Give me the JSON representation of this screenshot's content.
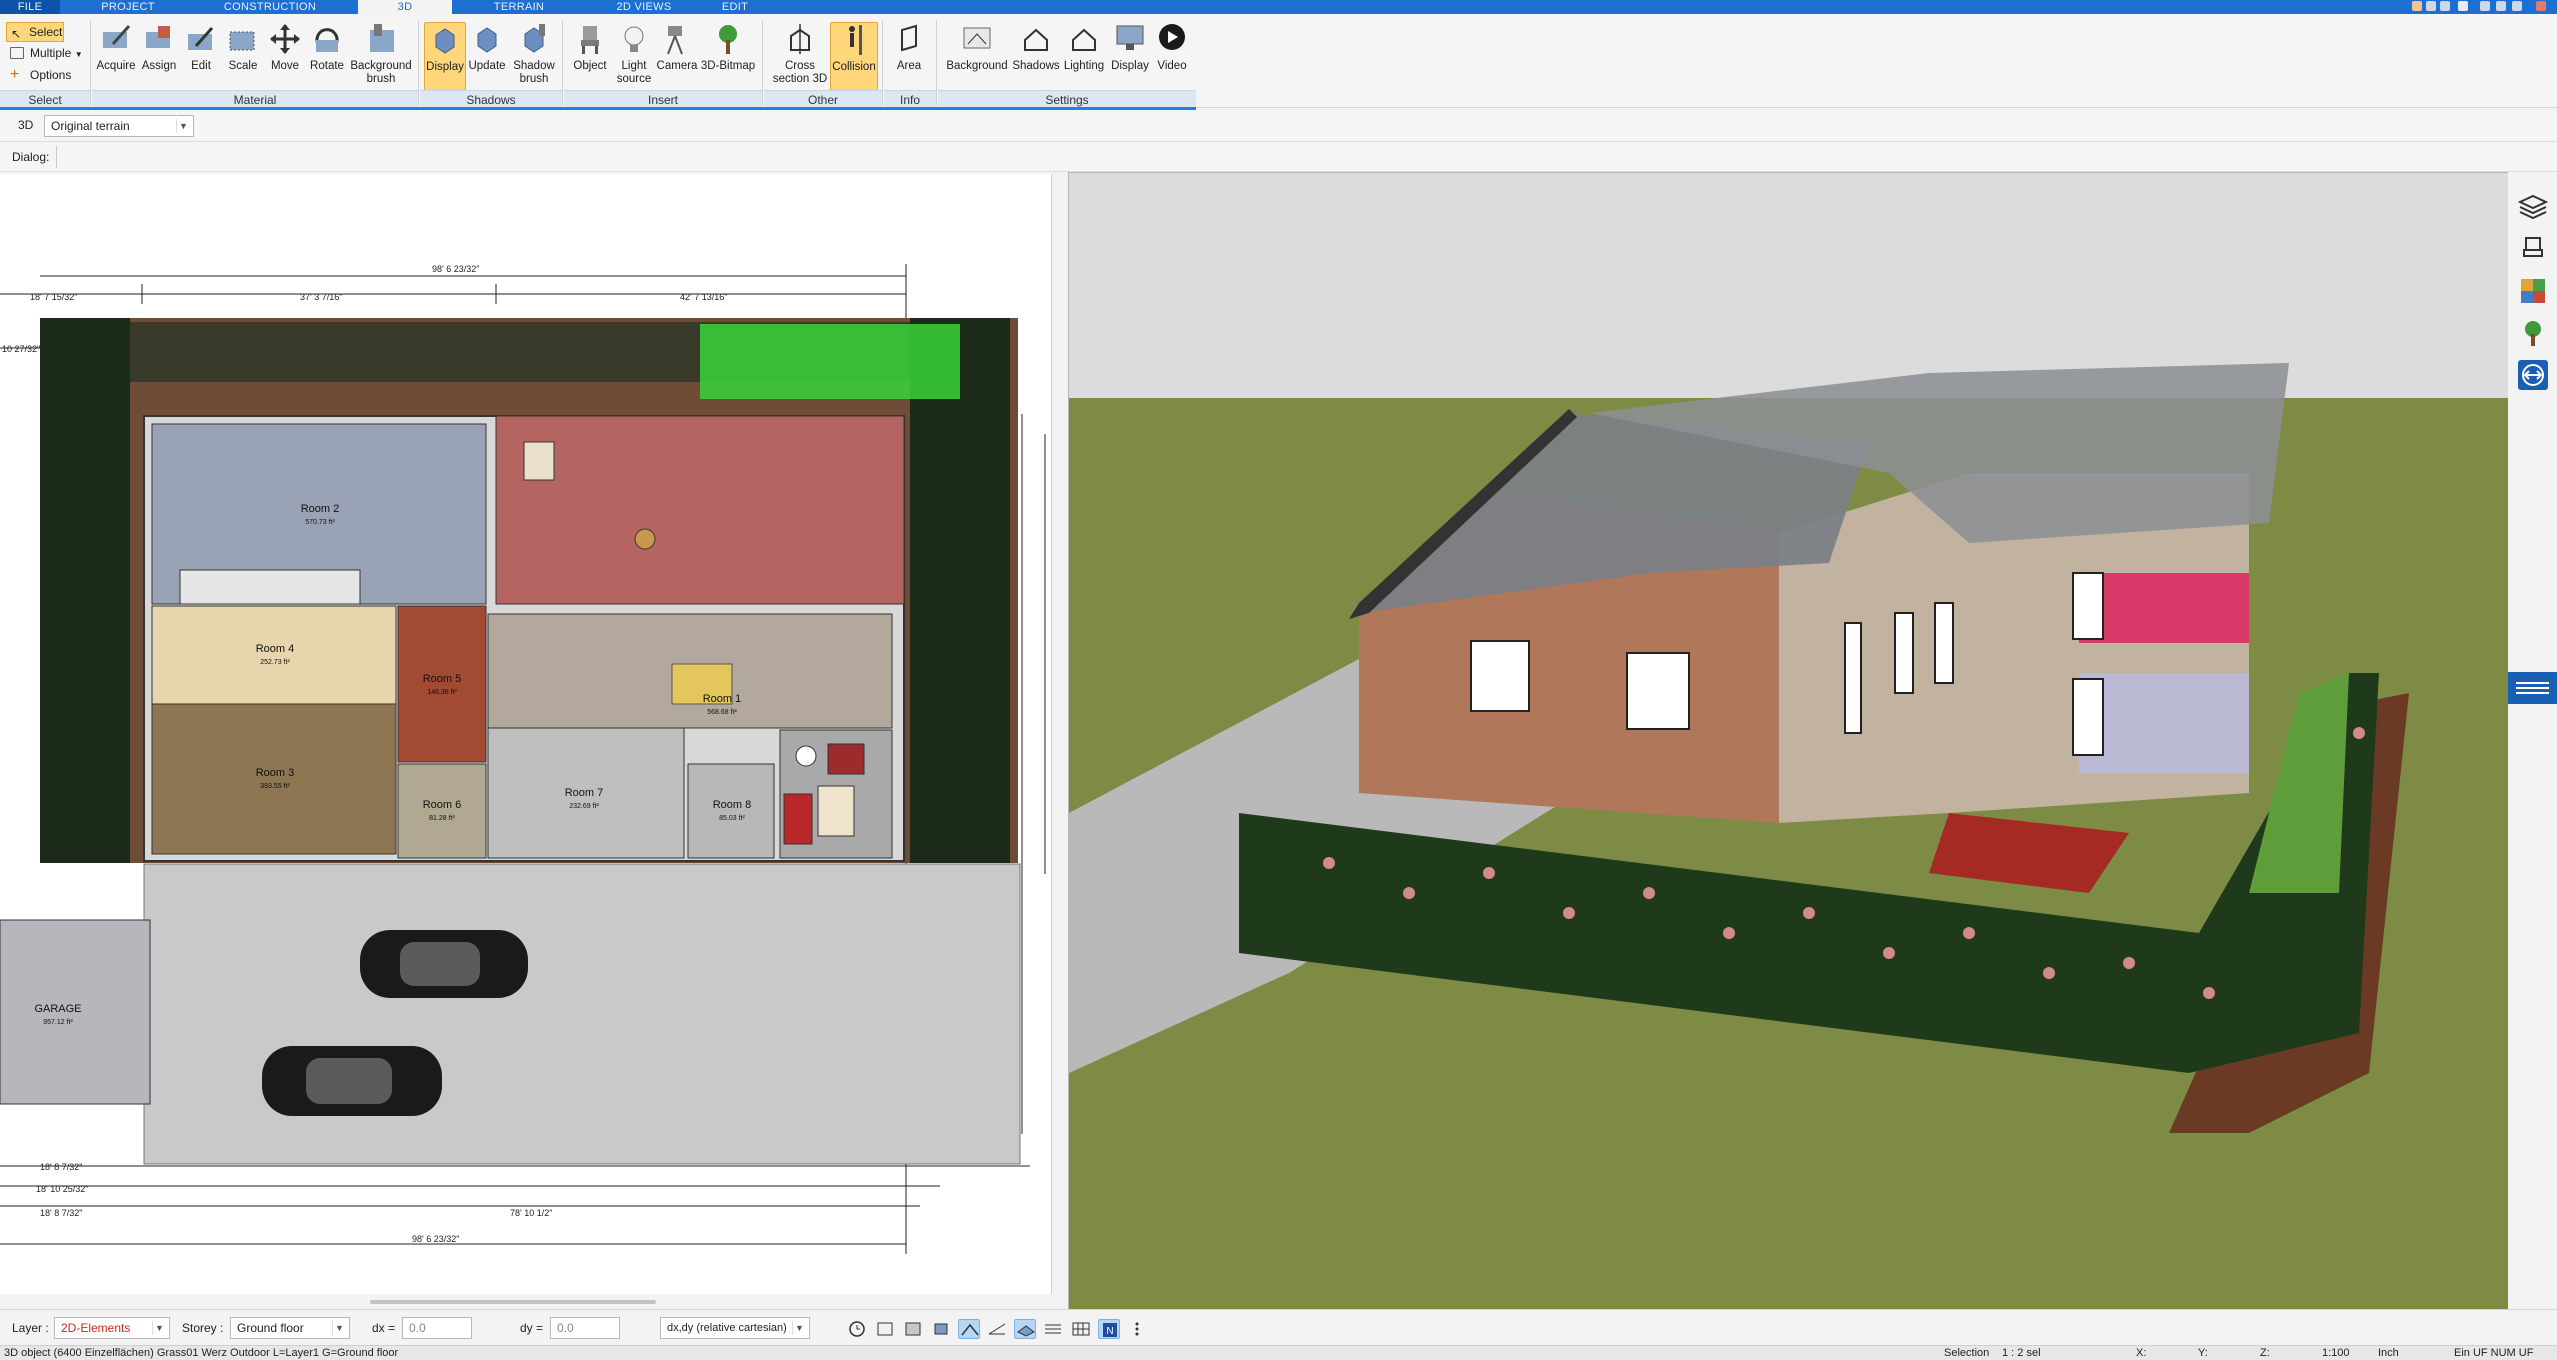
{
  "tabs": [
    {
      "label": "FILE"
    },
    {
      "label": "PROJECT"
    },
    {
      "label": "CONSTRUCTION"
    },
    {
      "label": "3D"
    },
    {
      "label": "TERRAIN"
    },
    {
      "label": "2D VIEWS"
    },
    {
      "label": "EDIT"
    }
  ],
  "ribbon": {
    "select": {
      "label": "Select",
      "multiple": "Multiple",
      "options": "Options",
      "group": "Select"
    },
    "material": {
      "group": "Material",
      "buttons": [
        "Acquire",
        "Assign",
        "Edit",
        "Scale",
        "Move",
        "Rotate",
        "Background brush"
      ]
    },
    "shadows": {
      "group": "Shadows",
      "buttons": [
        "Display",
        "Update",
        "Shadow brush"
      ]
    },
    "insert": {
      "group": "Insert",
      "buttons": [
        "Object",
        "Light source",
        "Camera",
        "3D-Bitmap"
      ]
    },
    "other": {
      "group": "Other",
      "buttons": [
        "Cross section 3D",
        "Collision"
      ]
    },
    "info": {
      "group": "Info",
      "buttons": [
        "Area"
      ]
    },
    "settings": {
      "group": "Settings",
      "buttons": [
        "Background",
        "Shadows",
        "Lighting",
        "Display",
        "Video"
      ]
    }
  },
  "context": {
    "mode": "3D",
    "terrain_select": "Original terrain"
  },
  "dialog": {
    "label": "Dialog:"
  },
  "plan": {
    "rooms": [
      {
        "name": "Room 2",
        "area": "570.73 ft²"
      },
      {
        "name": "Room 4",
        "area": "252.73 ft²"
      },
      {
        "name": "Room 3",
        "area": "393.55 ft²"
      },
      {
        "name": "Room 5",
        "area": "146.36 ft²"
      },
      {
        "name": "Room 1",
        "area": "568.68 ft²"
      },
      {
        "name": "Room 7",
        "area": "232.69 ft²"
      },
      {
        "name": "Room 6",
        "area": "81.28 ft²"
      },
      {
        "name": "Room 8",
        "area": "85.03 ft²"
      },
      {
        "name": "GARAGE",
        "area": "957.12 ft²"
      }
    ],
    "dimensions": {
      "top_total": "98' 6 23/32\"",
      "top_left": "37' 3 7/16\"",
      "top_right": "42' 7 13/16\"",
      "left_top": "18' 7 15/32\"",
      "left_small": "10 27/32\"",
      "bottom_1": "18' 8 7/32\"",
      "bottom_2": "18' 10 25/32\"",
      "bottom_3": "18' 8 7/32\"",
      "bottom_4": "78' 10 1/2\"",
      "bottom_total": "98' 6 23/32\""
    }
  },
  "bottombar": {
    "layer_label": "Layer :",
    "layer_value": "2D-Elements",
    "storey_label": "Storey :",
    "storey_value": "Ground floor",
    "dx_label": "dx =",
    "dx_value": "0.0",
    "dy_label": "dy =",
    "dy_value": "0.0",
    "coord_mode": "dx,dy (relative cartesian)"
  },
  "status": {
    "message": "3D object (6400 Einzelflächen) Grass01 Werz Outdoor L=Layer1 G=Ground floor",
    "selection_label": "Selection",
    "selection_value": "1 : 2 sel",
    "x": "X:",
    "y": "Y:",
    "z": "Z:",
    "scale": "1:100",
    "unit": "Inch",
    "flags": "Ein  UF  NUM  UF"
  },
  "colors": {
    "accent": "#1d6fd1",
    "active": "#ffd67a",
    "layer_red": "#d4261f"
  }
}
